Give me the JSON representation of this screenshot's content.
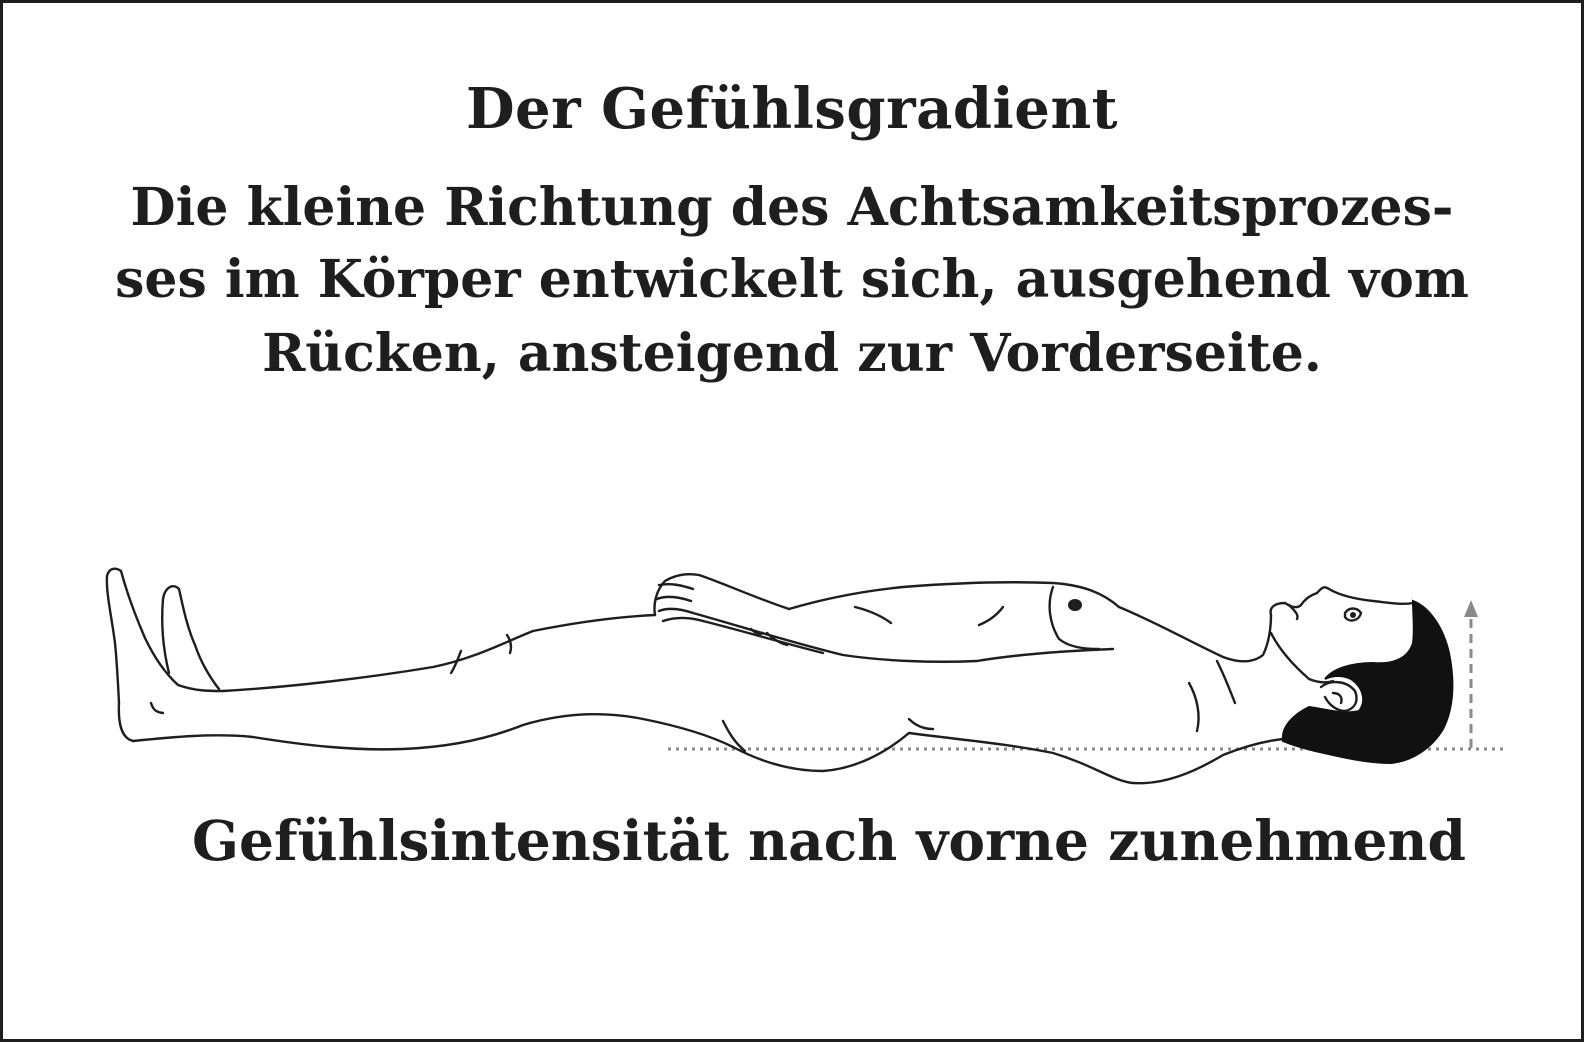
{
  "title": "Der Gefühlsgradient",
  "description_lines": [
    "Die kleine Richtung des Achtsamkeitsprozes-",
    "ses im Körper entwickelt sich, ausgehend vom",
    "Rücken, ansteigend zur Vorderseite."
  ],
  "caption": "Gefühlsintensität nach vorne zunehmend",
  "colors": {
    "ink": "#1e1e1e",
    "background": "#ffffff",
    "gradient_arrow": "#8a8a8a",
    "baseline": "#8a8a8a"
  },
  "icons": {
    "figure": "lying-person-outline",
    "arrow": "dashed-up-arrow",
    "baseline": "dotted-horizontal-line"
  }
}
